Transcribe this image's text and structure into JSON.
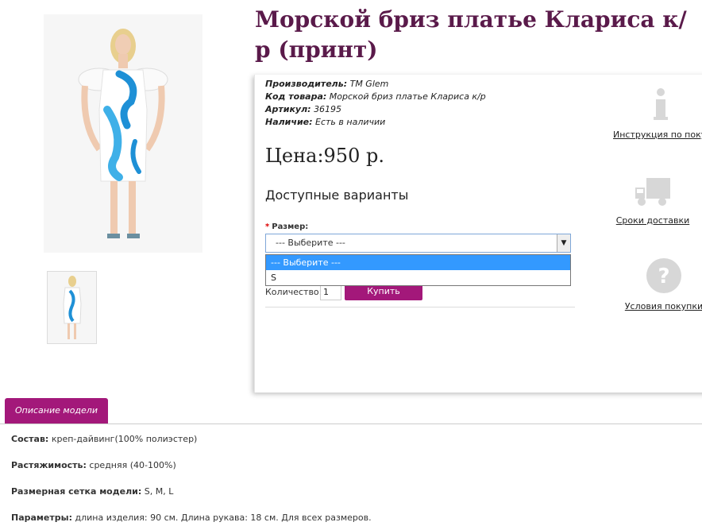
{
  "product": {
    "title": "Морской бриз платье Клариса к/р (принт)",
    "meta": [
      {
        "key": "Производитель:",
        "value": "TM Glem"
      },
      {
        "key": "Код товара:",
        "value": "Морской бриз платье Клариса к/р"
      },
      {
        "key": "Артикул:",
        "value": "36195"
      },
      {
        "key": "Наличие:",
        "value": "Есть в наличии"
      }
    ],
    "price": "Цена:950 р.",
    "variants_title": "Доступные варианты",
    "size_label": "Размер:",
    "size_required_mark": "*",
    "select_value": "--- Выберите ---",
    "dropdown_options": [
      "--- Выберите ---",
      "S"
    ],
    "qty_label": "Количество:",
    "qty_value": "1",
    "buy_label": "Купить"
  },
  "side": {
    "instruction": "Инструкция по покупке",
    "delivery": "Сроки доставки",
    "terms": "Условия покупки"
  },
  "tabs": {
    "description": "Описание модели"
  },
  "description": [
    {
      "key": "Состав:",
      "value": "креп-дайвинг(100% полиэстер)"
    },
    {
      "key": "Растяжимость:",
      "value": "средняя (40-100%)"
    },
    {
      "key": "Размерная сетка модели:",
      "value": "S, M, L"
    },
    {
      "key": "Параметры:",
      "value": "длина изделия: 90 см. Длина рукава: 18 см. Для всех размеров."
    }
  ],
  "colors": {
    "accent": "#a3187a",
    "title": "#5a1a4a",
    "select_highlight": "#3399ff"
  }
}
